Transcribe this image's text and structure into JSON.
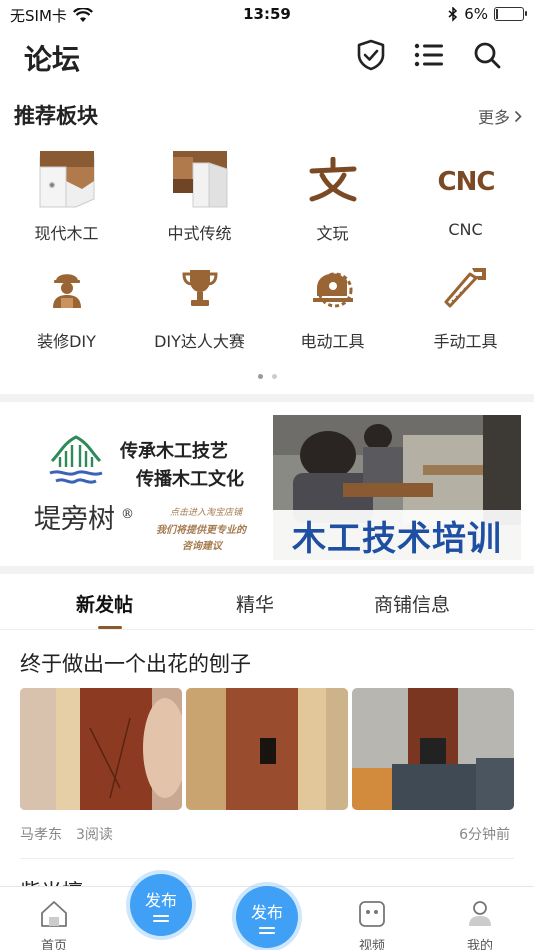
{
  "status_bar": {
    "carrier": "无SIM卡",
    "time": "13:59",
    "battery": "6%",
    "battery_level": 0.06
  },
  "header": {
    "title": "论坛"
  },
  "section": {
    "title": "推荐板块",
    "more": "更多"
  },
  "categories": [
    {
      "label": "现代木工",
      "icon": "modern-wood-icon"
    },
    {
      "label": "中式传统",
      "icon": "chinese-joint-icon"
    },
    {
      "label": "文玩",
      "icon": "wen-glyph-icon"
    },
    {
      "label": "CNC",
      "icon": "cnc-text-icon"
    },
    {
      "label": "装修DIY",
      "icon": "worker-icon"
    },
    {
      "label": "DIY达人大赛",
      "icon": "trophy-icon"
    },
    {
      "label": "电动工具",
      "icon": "circular-saw-icon"
    },
    {
      "label": "手动工具",
      "icon": "hand-saw-icon"
    }
  ],
  "banner": {
    "slogan_line1": "传承木工技艺",
    "slogan_line2": "传播木工文化",
    "brand": "堤旁树",
    "registered": "®",
    "small_line1": "点击进入淘宝店铺",
    "small_line2": "我们将提供更专业的",
    "small_line3": "咨询建议",
    "training": "木工技术培训"
  },
  "tabs": [
    "新发帖",
    "精华",
    "商铺信息"
  ],
  "post": {
    "title": "终于做出一个出花的刨子",
    "author": "马孝东",
    "reads": "3阅读",
    "time": "6分钟前"
  },
  "next_post": {
    "title": "紫光檀"
  },
  "tab_bar": {
    "home": "首页",
    "video": "视频",
    "mine": "我的",
    "fab_label": "发布"
  },
  "colors": {
    "accent": "#8b5a2b",
    "fab": "#3fa0f5"
  }
}
